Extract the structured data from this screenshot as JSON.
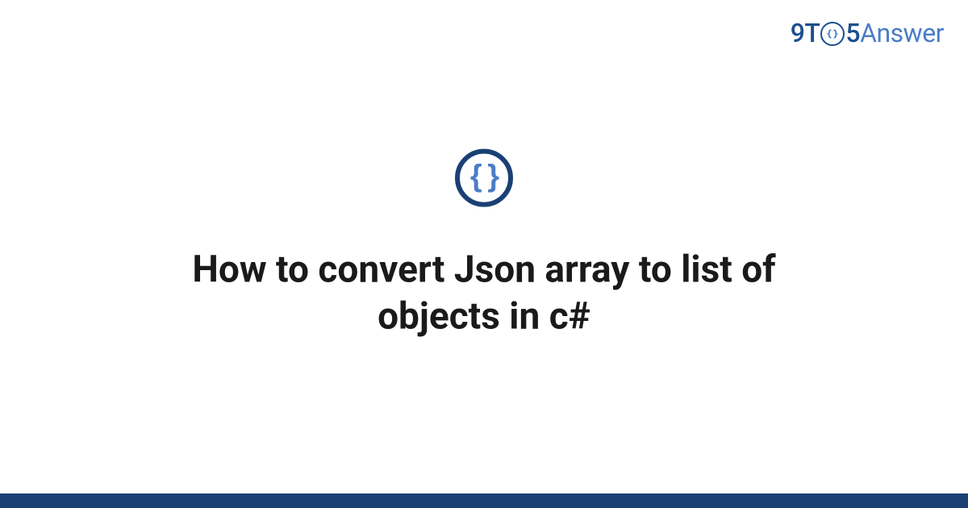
{
  "logo": {
    "prefix": "9T",
    "middle": "5",
    "suffix": "Answer"
  },
  "badge": {
    "symbol": "{ }"
  },
  "title": "How to convert Json array to list of objects in c#",
  "colors": {
    "primary_dark": "#1a4074",
    "primary_mid": "#1a4f8f",
    "accent_light": "#4a7dc7"
  }
}
